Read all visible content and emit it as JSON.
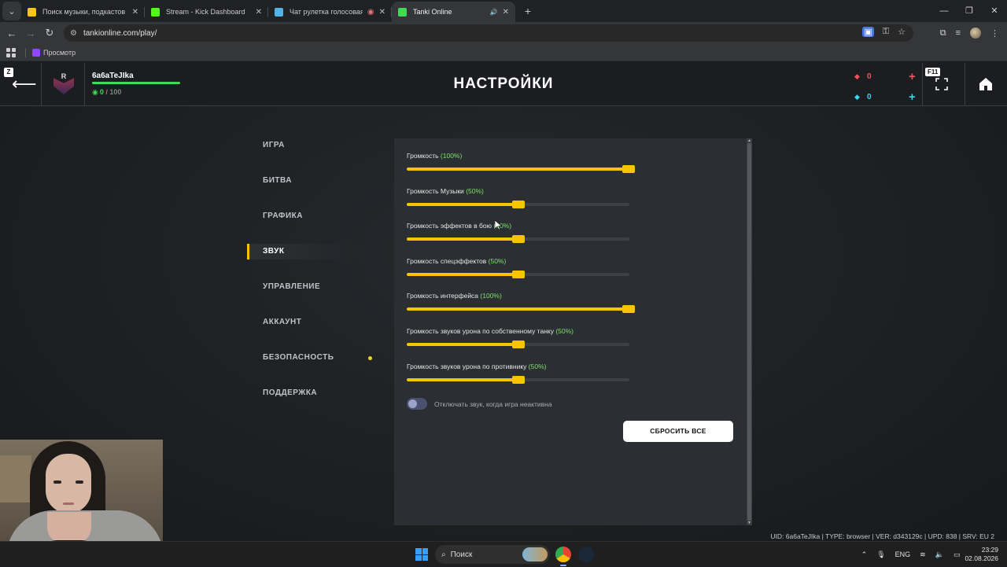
{
  "browser": {
    "tabs": [
      {
        "title": "Поиск музыки, подкастов и аудиокниг",
        "favicon_color": "#f5c518",
        "active": false
      },
      {
        "title": "Stream - Kick Dashboard",
        "favicon_color": "#53fc18",
        "active": false
      },
      {
        "title": "Чат рулетка голосовая — Чатрулетка",
        "favicon_color": "#4fb3e8",
        "active": false
      },
      {
        "title": "Tanki Online",
        "favicon_color": "#3ddc53",
        "active": true
      }
    ],
    "url": "tankionline.com/play/",
    "bookmark": "Просмотр"
  },
  "game": {
    "hotkey_z": "Z",
    "player": {
      "name": "6a6aTeJIka",
      "xp_current": "0",
      "xp_max": "/ 100",
      "xp_fraction": 1.0
    },
    "title": "НАСТРОЙКИ",
    "currencies": [
      {
        "name": "rubies",
        "value": "0",
        "color": "#ff4d5e",
        "icon": "ruby-icon"
      },
      {
        "name": "crystals",
        "value": "0",
        "color": "#38d6f0",
        "icon": "crystal-icon"
      }
    ],
    "hotkey_f11": "F11",
    "menu": [
      {
        "label": "ИГРА",
        "active": false,
        "notification": false
      },
      {
        "label": "БИТВА",
        "active": false,
        "notification": false
      },
      {
        "label": "ГРАФИКА",
        "active": false,
        "notification": false
      },
      {
        "label": "ЗВУК",
        "active": true,
        "notification": false
      },
      {
        "label": "УПРАВЛЕНИЕ",
        "active": false,
        "notification": false
      },
      {
        "label": "АККАУНТ",
        "active": false,
        "notification": false
      },
      {
        "label": "БЕЗОПАСНОСТЬ",
        "active": false,
        "notification": true
      },
      {
        "label": "ПОДДЕРЖКА",
        "active": false,
        "notification": false
      }
    ],
    "sliders": [
      {
        "label": "Громкость",
        "pct_text": "(100%)",
        "value": 1.0
      },
      {
        "label": "Громкость Музыки",
        "pct_text": "(50%)",
        "value": 0.5
      },
      {
        "label": "Громкость эффектов в бою",
        "pct_text": "(50%)",
        "value": 0.5
      },
      {
        "label": "Громкость спецэффектов",
        "pct_text": "(50%)",
        "value": 0.5
      },
      {
        "label": "Громкость интерфейса",
        "pct_text": "(100%)",
        "value": 1.0
      },
      {
        "label": "Громкость звуков урона по собственному танку",
        "pct_text": "(50%)",
        "value": 0.5
      },
      {
        "label": "Громкость звуков урона по противнику",
        "pct_text": "(50%)",
        "value": 0.5
      }
    ],
    "mute_toggle": {
      "label": "Отключать звук, когда игра неактивна",
      "on": false
    },
    "reset_button": "СБРОСИТЬ ВСЕ",
    "build_info": "UID: 6a6aTeJIka | TYPE: browser | VER: d343129c | UPD: 838 | SRV: EU 2"
  },
  "taskbar": {
    "search_placeholder": "Поиск",
    "language": "ENG",
    "time": "23:29",
    "date": "02.08.2026"
  }
}
